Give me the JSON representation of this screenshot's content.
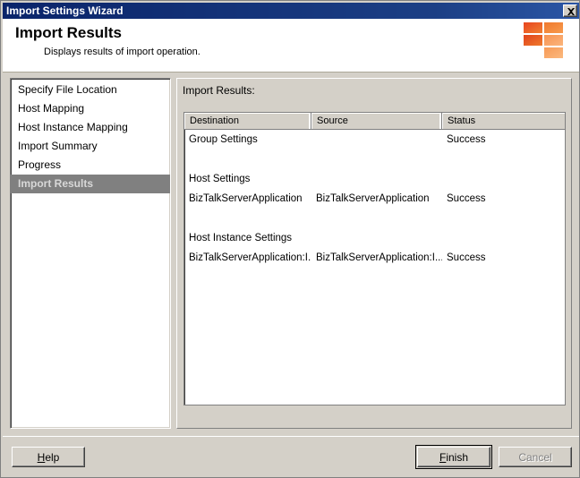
{
  "window": {
    "title": "Import Settings Wizard",
    "close_button": "close-icon",
    "close_label": "Close"
  },
  "header": {
    "title": "Import Results",
    "subtitle": "Displays results of import operation.",
    "logo": {
      "name": "biztalk-logo",
      "colors": [
        "#e8502a",
        "#f0752f",
        "#e04a26",
        "#f99d5c",
        "#f9a05a"
      ]
    }
  },
  "sidebar": {
    "items": [
      {
        "label": "Specify File Location",
        "selected": false
      },
      {
        "label": "Host Mapping",
        "selected": false
      },
      {
        "label": "Host Instance Mapping",
        "selected": false
      },
      {
        "label": "Import Summary",
        "selected": false
      },
      {
        "label": "Progress",
        "selected": false
      },
      {
        "label": "Import Results",
        "selected": true
      }
    ]
  },
  "panel": {
    "label": "Import Results:",
    "table": {
      "columns": [
        "Destination",
        "Source",
        "Status"
      ],
      "rows": [
        {
          "destination": "Group Settings",
          "source": "",
          "status": "Success"
        },
        {
          "destination": "",
          "source": "",
          "status": ""
        },
        {
          "destination": "Host Settings",
          "source": "",
          "status": ""
        },
        {
          "destination": "BizTalkServerApplication",
          "source": "BizTalkServerApplication",
          "status": "Success"
        },
        {
          "destination": "",
          "source": "",
          "status": ""
        },
        {
          "destination": "Host Instance Settings",
          "source": "",
          "status": ""
        },
        {
          "destination": "BizTalkServerApplication:I...",
          "source": "BizTalkServerApplication:I...",
          "status": "Success"
        }
      ]
    }
  },
  "footer": {
    "help_label": "Help",
    "help_accel": "H",
    "finish_label": "Finish",
    "finish_accel": "F",
    "cancel_label": "Cancel",
    "cancel_disabled": true
  },
  "colors": {
    "titlebar": "#0a246a",
    "face": "#d4d0c8",
    "selection": "#808080",
    "accent": "#e8502a"
  }
}
